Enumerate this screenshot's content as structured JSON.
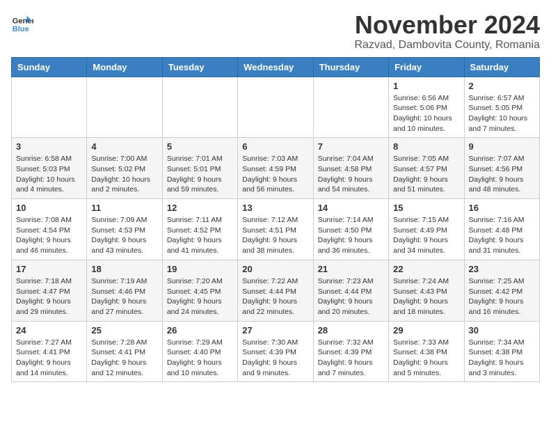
{
  "logo": {
    "line1": "General",
    "line2": "Blue"
  },
  "title": "November 2024",
  "subtitle": "Razvad, Dambovita County, Romania",
  "days_of_week": [
    "Sunday",
    "Monday",
    "Tuesday",
    "Wednesday",
    "Thursday",
    "Friday",
    "Saturday"
  ],
  "weeks": [
    [
      {
        "day": "",
        "info": ""
      },
      {
        "day": "",
        "info": ""
      },
      {
        "day": "",
        "info": ""
      },
      {
        "day": "",
        "info": ""
      },
      {
        "day": "",
        "info": ""
      },
      {
        "day": "1",
        "info": "Sunrise: 6:56 AM\nSunset: 5:06 PM\nDaylight: 10 hours and 10 minutes."
      },
      {
        "day": "2",
        "info": "Sunrise: 6:57 AM\nSunset: 5:05 PM\nDaylight: 10 hours and 7 minutes."
      }
    ],
    [
      {
        "day": "3",
        "info": "Sunrise: 6:58 AM\nSunset: 5:03 PM\nDaylight: 10 hours and 4 minutes."
      },
      {
        "day": "4",
        "info": "Sunrise: 7:00 AM\nSunset: 5:02 PM\nDaylight: 10 hours and 2 minutes."
      },
      {
        "day": "5",
        "info": "Sunrise: 7:01 AM\nSunset: 5:01 PM\nDaylight: 9 hours and 59 minutes."
      },
      {
        "day": "6",
        "info": "Sunrise: 7:03 AM\nSunset: 4:59 PM\nDaylight: 9 hours and 56 minutes."
      },
      {
        "day": "7",
        "info": "Sunrise: 7:04 AM\nSunset: 4:58 PM\nDaylight: 9 hours and 54 minutes."
      },
      {
        "day": "8",
        "info": "Sunrise: 7:05 AM\nSunset: 4:57 PM\nDaylight: 9 hours and 51 minutes."
      },
      {
        "day": "9",
        "info": "Sunrise: 7:07 AM\nSunset: 4:56 PM\nDaylight: 9 hours and 48 minutes."
      }
    ],
    [
      {
        "day": "10",
        "info": "Sunrise: 7:08 AM\nSunset: 4:54 PM\nDaylight: 9 hours and 46 minutes."
      },
      {
        "day": "11",
        "info": "Sunrise: 7:09 AM\nSunset: 4:53 PM\nDaylight: 9 hours and 43 minutes."
      },
      {
        "day": "12",
        "info": "Sunrise: 7:11 AM\nSunset: 4:52 PM\nDaylight: 9 hours and 41 minutes."
      },
      {
        "day": "13",
        "info": "Sunrise: 7:12 AM\nSunset: 4:51 PM\nDaylight: 9 hours and 38 minutes."
      },
      {
        "day": "14",
        "info": "Sunrise: 7:14 AM\nSunset: 4:50 PM\nDaylight: 9 hours and 36 minutes."
      },
      {
        "day": "15",
        "info": "Sunrise: 7:15 AM\nSunset: 4:49 PM\nDaylight: 9 hours and 34 minutes."
      },
      {
        "day": "16",
        "info": "Sunrise: 7:16 AM\nSunset: 4:48 PM\nDaylight: 9 hours and 31 minutes."
      }
    ],
    [
      {
        "day": "17",
        "info": "Sunrise: 7:18 AM\nSunset: 4:47 PM\nDaylight: 9 hours and 29 minutes."
      },
      {
        "day": "18",
        "info": "Sunrise: 7:19 AM\nSunset: 4:46 PM\nDaylight: 9 hours and 27 minutes."
      },
      {
        "day": "19",
        "info": "Sunrise: 7:20 AM\nSunset: 4:45 PM\nDaylight: 9 hours and 24 minutes."
      },
      {
        "day": "20",
        "info": "Sunrise: 7:22 AM\nSunset: 4:44 PM\nDaylight: 9 hours and 22 minutes."
      },
      {
        "day": "21",
        "info": "Sunrise: 7:23 AM\nSunset: 4:44 PM\nDaylight: 9 hours and 20 minutes."
      },
      {
        "day": "22",
        "info": "Sunrise: 7:24 AM\nSunset: 4:43 PM\nDaylight: 9 hours and 18 minutes."
      },
      {
        "day": "23",
        "info": "Sunrise: 7:25 AM\nSunset: 4:42 PM\nDaylight: 9 hours and 16 minutes."
      }
    ],
    [
      {
        "day": "24",
        "info": "Sunrise: 7:27 AM\nSunset: 4:41 PM\nDaylight: 9 hours and 14 minutes."
      },
      {
        "day": "25",
        "info": "Sunrise: 7:28 AM\nSunset: 4:41 PM\nDaylight: 9 hours and 12 minutes."
      },
      {
        "day": "26",
        "info": "Sunrise: 7:29 AM\nSunset: 4:40 PM\nDaylight: 9 hours and 10 minutes."
      },
      {
        "day": "27",
        "info": "Sunrise: 7:30 AM\nSunset: 4:39 PM\nDaylight: 9 hours and 9 minutes."
      },
      {
        "day": "28",
        "info": "Sunrise: 7:32 AM\nSunset: 4:39 PM\nDaylight: 9 hours and 7 minutes."
      },
      {
        "day": "29",
        "info": "Sunrise: 7:33 AM\nSunset: 4:38 PM\nDaylight: 9 hours and 5 minutes."
      },
      {
        "day": "30",
        "info": "Sunrise: 7:34 AM\nSunset: 4:38 PM\nDaylight: 9 hours and 3 minutes."
      }
    ]
  ]
}
